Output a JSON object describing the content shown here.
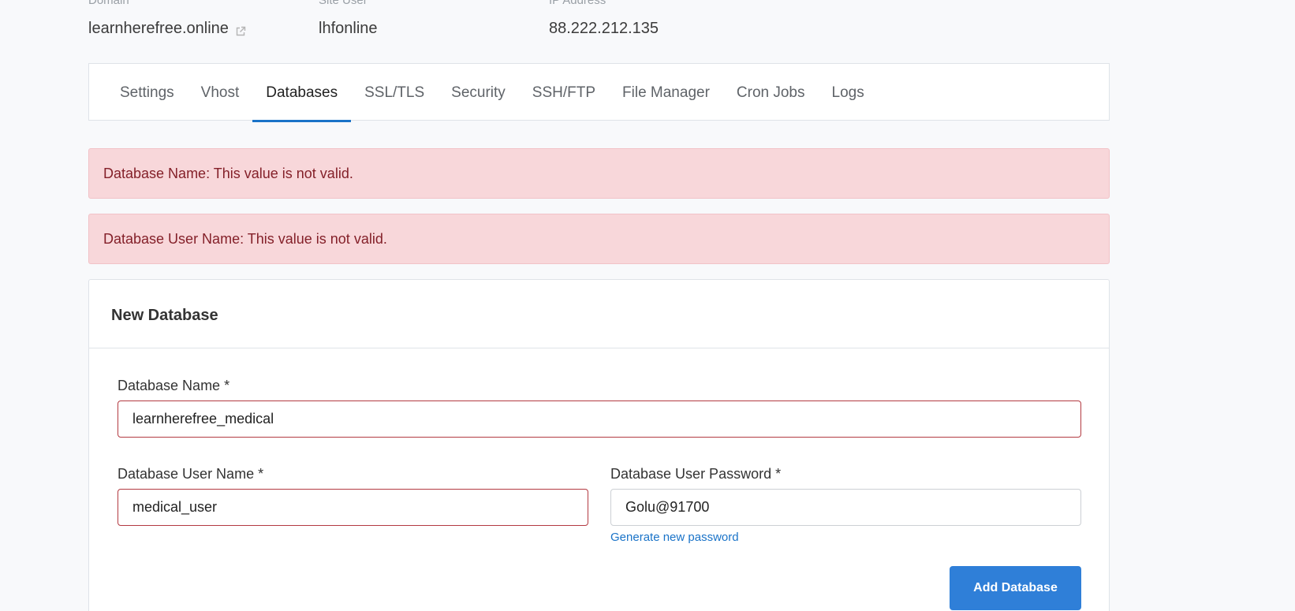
{
  "site_info": {
    "domain": {
      "label": "Domain",
      "value": "learnherefree.online"
    },
    "site_user": {
      "label": "Site User",
      "value": "lhfonline"
    },
    "ip_address": {
      "label": "IP Address",
      "value": "88.222.212.135"
    }
  },
  "tabs": [
    {
      "label": "Settings"
    },
    {
      "label": "Vhost"
    },
    {
      "label": "Databases"
    },
    {
      "label": "SSL/TLS"
    },
    {
      "label": "Security"
    },
    {
      "label": "SSH/FTP"
    },
    {
      "label": "File Manager"
    },
    {
      "label": "Cron Jobs"
    },
    {
      "label": "Logs"
    }
  ],
  "active_tab": "Databases",
  "alerts": [
    {
      "text": "Database Name: This value is not valid."
    },
    {
      "text": "Database User Name: This value is not valid."
    }
  ],
  "new_database": {
    "title": "New Database",
    "db_name": {
      "label": "Database Name *",
      "value": "learnherefree_medical"
    },
    "db_user": {
      "label": "Database User Name *",
      "value": "medical_user"
    },
    "db_password": {
      "label": "Database User Password *",
      "value": "Golu@91700"
    },
    "generate_link": "Generate new password",
    "submit_label": "Add Database"
  },
  "colors": {
    "accent": "#2f7fd8",
    "alert_bg": "#f8d7da",
    "alert_text": "#842029",
    "invalid_border": "#b33a41"
  }
}
